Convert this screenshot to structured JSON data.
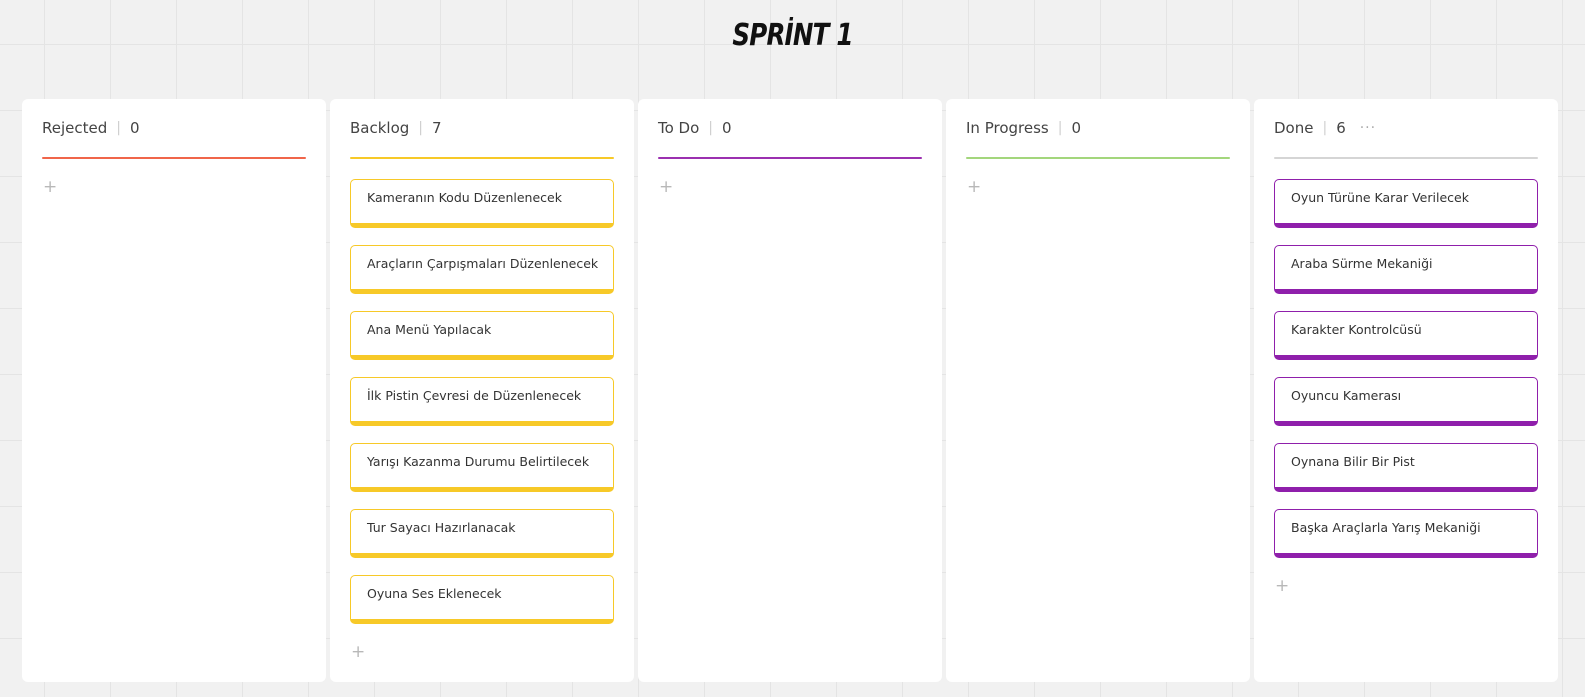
{
  "board": {
    "title": "SPRİNT 1"
  },
  "columns": [
    {
      "name": "Rejected",
      "count": "0",
      "color": "#f0654a",
      "cards": []
    },
    {
      "name": "Backlog",
      "count": "7",
      "color": "#f7c928",
      "cards": [
        "Kameranın Kodu Düzenlenecek",
        "Araçların Çarpışmaları Düzenlenecek",
        "Ana Menü Yapılacak",
        "İlk Pistin Çevresi de Düzenlenecek",
        "Yarışı Kazanma Durumu Belirtilecek",
        "Tur Sayacı Hazırlanacak",
        "Oyuna Ses Eklenecek"
      ]
    },
    {
      "name": "To Do",
      "count": "0",
      "color": "#9b30b0",
      "cards": []
    },
    {
      "name": "In Progress",
      "count": "0",
      "color": "#a3d67c",
      "cards": []
    },
    {
      "name": "Done",
      "count": "6",
      "color": "#d5d5d5",
      "card_color": "#8f1fab",
      "more_label": "···",
      "cards": [
        "Oyun Türüne Karar Verilecek",
        "Araba Sürme Mekaniği",
        "Karakter Kontrolcüsü",
        "Oyuncu Kamerası",
        "Oynana Bilir Bir Pist",
        "Başka Araçlarla Yarış Mekaniği"
      ]
    }
  ],
  "add_icon": "+",
  "card_colors": {
    "backlog": "#f7c928",
    "done": "#8f1fab"
  }
}
